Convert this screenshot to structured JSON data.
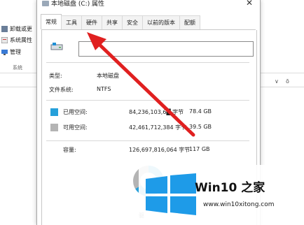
{
  "explorer": {
    "ribbon_items": [
      "卸载或更",
      "系统属性",
      "管理"
    ],
    "ribbon_group": "系统",
    "right_controls": [
      "∨",
      "ō"
    ]
  },
  "dialog": {
    "title": "本地磁盘 (C:) 属性",
    "close_glyph": "✕",
    "tabs": [
      "常规",
      "工具",
      "硬件",
      "共享",
      "安全",
      "以前的版本",
      "配额"
    ],
    "active_tab": "常规",
    "name_value": "",
    "type_label": "类型:",
    "type_value": "本地磁盘",
    "fs_label": "文件系统:",
    "fs_value": "NTFS",
    "used": {
      "label": "已用空间:",
      "bytes": "84,236,103,6█ 字节",
      "gb": "78.4 GB",
      "color": "#26a0da"
    },
    "free": {
      "label": "可用空间:",
      "bytes": "42,461,712,384 字节",
      "gb": "39.5 GB",
      "color": "#b4b4b4"
    },
    "capacity": {
      "label": "容量:",
      "bytes": "126,697,816,064 字节",
      "gb": "117 GB"
    },
    "used_fraction": 0.665,
    "drive_label": "驱"
  },
  "annotation": {
    "arrow_color": "#e02020",
    "points_to": "工具"
  },
  "watermark": {
    "text": "Win10 之家",
    "url": "www.win10xitong.com",
    "colors": [
      "#1e9be8",
      "#1e9be8"
    ]
  }
}
